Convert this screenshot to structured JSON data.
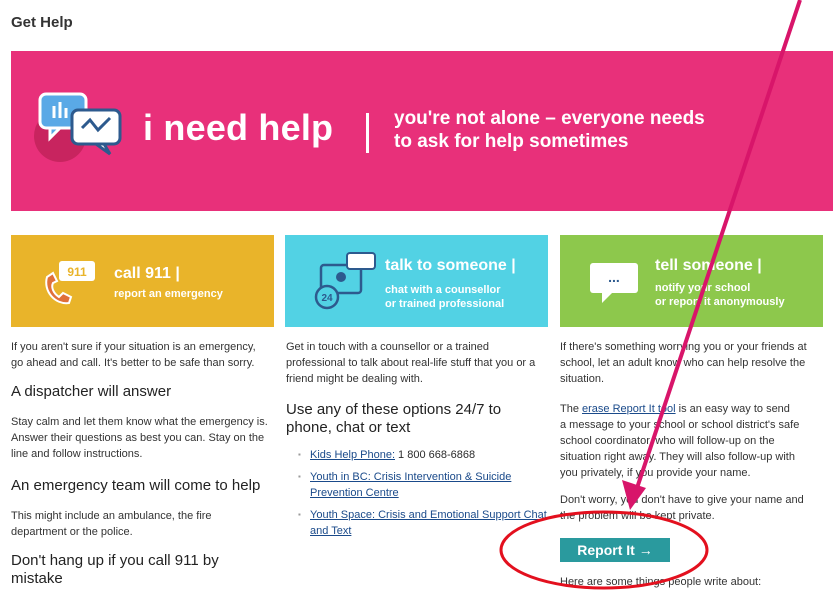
{
  "page": {
    "title": "Get Help"
  },
  "hero": {
    "title": "i need help",
    "tagline_line1": "you're not alone – everyone needs",
    "tagline_line2": "to ask for help sometimes"
  },
  "cards": {
    "call": {
      "title": "call 911 |",
      "subtitle": "report an emergency",
      "badge": "911"
    },
    "talk": {
      "title": "talk to someone |",
      "subtitle_line1": "chat with a counsellor",
      "subtitle_line2": "or trained professional",
      "badge": "24"
    },
    "tell": {
      "title": "tell someone |",
      "subtitle_line1": "notify your school",
      "subtitle_line2": "or report it anonymously",
      "bubble": "..."
    }
  },
  "col1": {
    "intro_line1": "If you aren't sure if your situation is an emergency,",
    "intro_line2": "go ahead and call. It's better to be safe than sorry.",
    "h1": "A dispatcher will answer",
    "p1_line1": "Stay calm and let them know what the emergency is.",
    "p1_line2": "Answer their questions as best you can. Stay on the",
    "p1_line3": "line and follow instructions.",
    "h2": "An emergency team will come to help",
    "p2_line1": "This might include an ambulance, the fire",
    "p2_line2": "department or the police.",
    "h3_line1": "Don't hang up if you call 911 by",
    "h3_line2": "mistake"
  },
  "col2": {
    "intro_line1": "Get in touch with a counsellor or a trained",
    "intro_line2": "professional to talk about real-life stuff that you or a",
    "intro_line3": "friend might be dealing with.",
    "h1_line1": "Use any of these options 24/7 to",
    "h1_line2": "phone, chat or text",
    "options": [
      {
        "link": "Kids Help Phone:",
        "text": " 1 800 668-6868"
      },
      {
        "link": "Youth in BC: Crisis Intervention & Suicide",
        "link2": "Prevention Centre"
      },
      {
        "link": "Youth Space: Crisis and Emotional Support Chat",
        "link2": "and Text"
      }
    ]
  },
  "col3": {
    "intro_line1": "If there's something worrying you or your friends at",
    "intro_line2": "school, let an adult know who can help resolve the",
    "intro_line3": "situation.",
    "p1_pre": "The ",
    "p1_link": "erase Report It tool",
    "p1_post": " is an easy way to send",
    "p1_line2": "a message to your school or school district's safe",
    "p1_line3": "school coordinator, who will follow-up on the",
    "p1_line4": "situation right away. They will also follow-up with",
    "p1_line5": "you privately, if you provide your name.",
    "p2_line1": "Don't worry, you don't have to give your name and",
    "p2_line2": "the problem will be kept private.",
    "button_label": "Report It →",
    "trailing": "Here are some things people write about:"
  },
  "colors": {
    "hero": "#e8307a",
    "card_911": "#e9b42a",
    "card_talk": "#52d2e4",
    "card_tell": "#8dc84c",
    "button": "#2a9a9e",
    "annotation": "#d8156a"
  }
}
